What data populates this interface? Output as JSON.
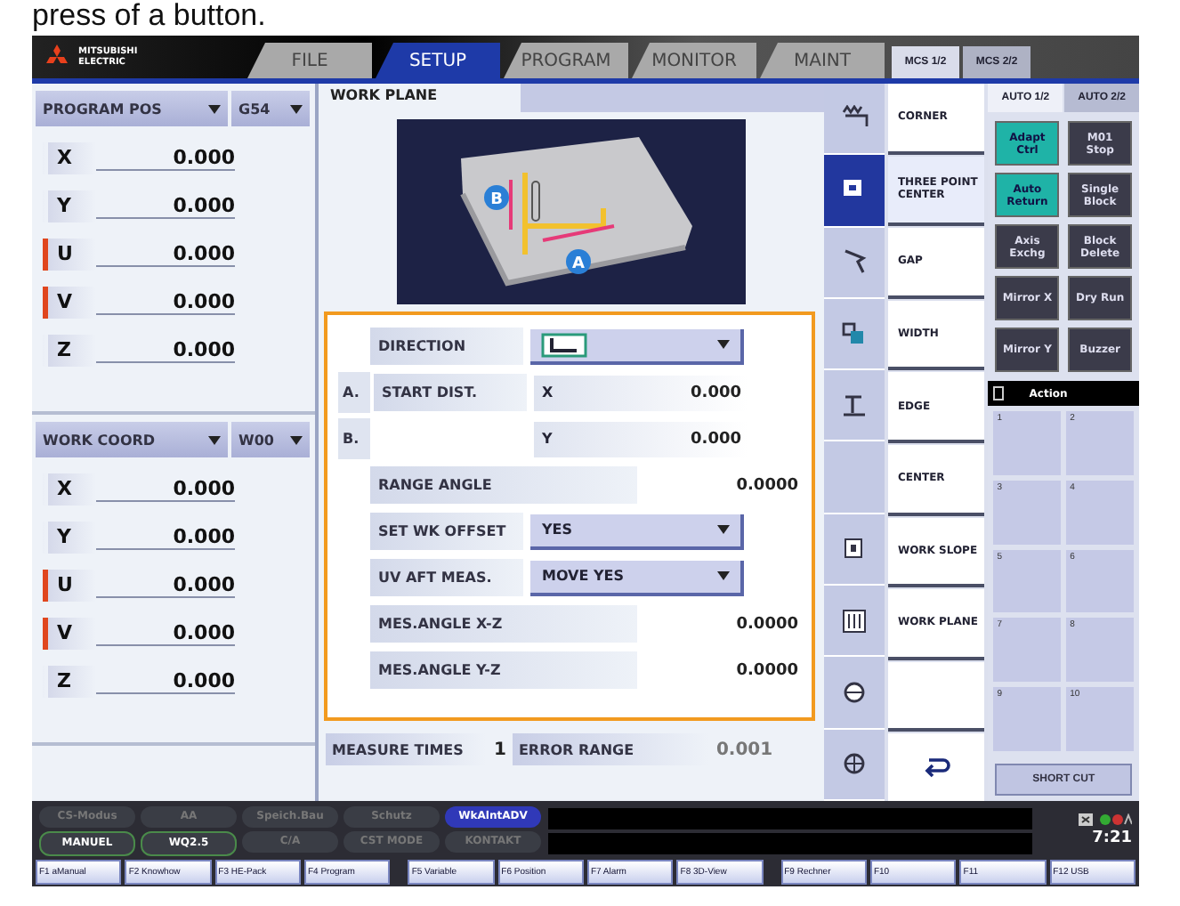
{
  "caption": "press of a button.",
  "header": {
    "logo": [
      "MITSUBISHI",
      "ELECTRIC"
    ],
    "tabs": [
      {
        "label": "FILE",
        "selected": false
      },
      {
        "label": "SETUP",
        "selected": true
      },
      {
        "label": "PROGRAM",
        "selected": false
      },
      {
        "label": "MONITOR",
        "selected": false
      },
      {
        "label": "MAINT",
        "selected": false
      }
    ],
    "mcs_tabs": [
      {
        "label": "MCS 1/2",
        "selected": true
      },
      {
        "label": "MCS 2/2",
        "selected": false
      }
    ]
  },
  "position_panels": [
    {
      "mode": "PROGRAM POS",
      "coord": "G54",
      "rows": [
        {
          "axis": "X",
          "value": "0.000",
          "flagged": false
        },
        {
          "axis": "Y",
          "value": "0.000",
          "flagged": false
        },
        {
          "axis": "U",
          "value": "0.000",
          "flagged": true
        },
        {
          "axis": "V",
          "value": "0.000",
          "flagged": true
        },
        {
          "axis": "Z",
          "value": "0.000",
          "flagged": false
        }
      ]
    },
    {
      "mode": "WORK COORD",
      "coord": "W00",
      "rows": [
        {
          "axis": "X",
          "value": "0.000",
          "flagged": false
        },
        {
          "axis": "Y",
          "value": "0.000",
          "flagged": false
        },
        {
          "axis": "U",
          "value": "0.000",
          "flagged": true
        },
        {
          "axis": "V",
          "value": "0.000",
          "flagged": true
        },
        {
          "axis": "Z",
          "value": "0.000",
          "flagged": false
        }
      ]
    }
  ],
  "work_plane": {
    "title": "WORK PLANE",
    "figure_labels": [
      "B",
      "A"
    ],
    "fields": [
      {
        "kind": "icon-select",
        "label": "DIRECTION"
      },
      {
        "kind": "axis",
        "prefix": "A.",
        "label": "START DIST.",
        "axis": "X",
        "value": "0.000"
      },
      {
        "kind": "axis",
        "prefix": "B.",
        "axis": "Y",
        "value": "0.000"
      },
      {
        "kind": "value",
        "label": "RANGE ANGLE",
        "value": "0.0000"
      },
      {
        "kind": "select",
        "label": "SET WK OFFSET",
        "value": "YES"
      },
      {
        "kind": "select",
        "label": "UV AFT MEAS.",
        "value": "MOVE YES"
      },
      {
        "kind": "value",
        "label": "MES.ANGLE X-Z",
        "value": "0.0000"
      },
      {
        "kind": "value",
        "label": "MES.ANGLE Y-Z",
        "value": "0.0000"
      }
    ],
    "measure_times_label": "MEASURE TIMES",
    "measure_times": "1",
    "error_range_label": "ERROR RANGE",
    "error_range": "0.001"
  },
  "menu": [
    {
      "kind": "item",
      "label": "CORNER",
      "selected": false
    },
    {
      "kind": "item",
      "label": "THREE POINT CENTER",
      "selected": true
    },
    {
      "kind": "item",
      "label": "GAP",
      "selected": false
    },
    {
      "kind": "item",
      "label": "WIDTH",
      "selected": false
    },
    {
      "kind": "item",
      "label": "EDGE",
      "selected": false
    },
    {
      "kind": "item",
      "label": "CENTER",
      "selected": false
    },
    {
      "kind": "item",
      "label": "WORK SLOPE",
      "selected": false
    },
    {
      "kind": "item",
      "label": "WORK PLANE",
      "selected": false
    },
    {
      "kind": "blank",
      "selected": false
    },
    {
      "kind": "return",
      "selected": false
    }
  ],
  "auto_tabs": [
    {
      "label": "AUTO 1/2",
      "selected": true
    },
    {
      "label": "AUTO 2/2",
      "selected": false
    }
  ],
  "toggles": [
    {
      "label": "Adapt Ctrl",
      "on": true
    },
    {
      "label": "M01 Stop",
      "on": false
    },
    {
      "label": "Auto Return",
      "on": true
    },
    {
      "label": "Single Block",
      "on": false
    },
    {
      "label": "Axis Exchg",
      "on": false
    },
    {
      "label": "Block Delete",
      "on": false
    },
    {
      "label": "Mirror X",
      "on": false
    },
    {
      "label": "Dry Run",
      "on": false
    },
    {
      "label": "Mirror Y",
      "on": false
    },
    {
      "label": "Buzzer",
      "on": false
    }
  ],
  "action": {
    "title": "Action",
    "slots": [
      "1",
      "2",
      "3",
      "4",
      "5",
      "6",
      "7",
      "8",
      "9",
      "10"
    ]
  },
  "shortcut": "SHORT CUT",
  "status": {
    "modes": [
      {
        "label": "CS-Modus",
        "kind": "dim"
      },
      {
        "label": "AA",
        "kind": "dim"
      },
      {
        "label": "Speich.Bau",
        "kind": "dim"
      },
      {
        "label": "Schutz",
        "kind": "dim"
      },
      {
        "label": "WkAlntADV",
        "kind": "highlight"
      },
      {
        "label": "MANUEL",
        "kind": "lit"
      },
      {
        "label": "WQ2.5",
        "kind": "lit"
      },
      {
        "label": "C/A",
        "kind": "dim"
      },
      {
        "label": "CST MODE",
        "kind": "dim"
      },
      {
        "label": "KONTAKT",
        "kind": "dim"
      }
    ],
    "time": "7:21",
    "fkeys": [
      "F1 aManual",
      "F2 Knowhow",
      "F3 HE-Pack",
      "F4 Program",
      "F5 Variable",
      "F6 Position",
      "F7 Alarm",
      "F8 3D-View",
      "F9 Rechner",
      "F10",
      "F11",
      "F12 USB"
    ]
  }
}
